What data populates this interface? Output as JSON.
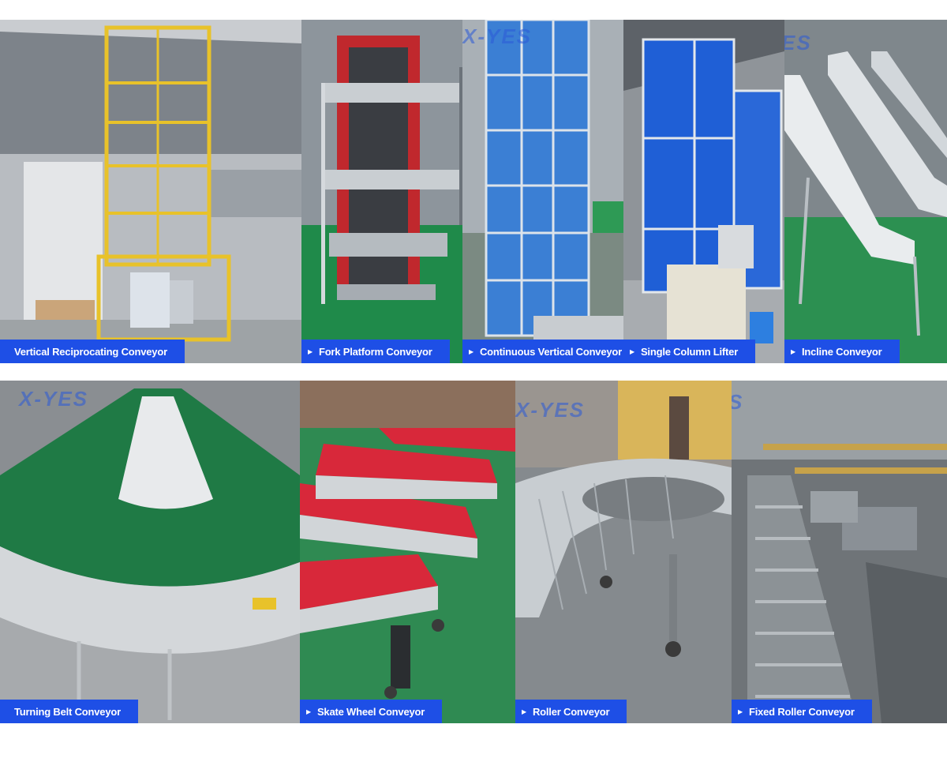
{
  "watermark": "X-YES",
  "row1": [
    {
      "label": "Vertical Reciprocating Conveyor",
      "arrow": false
    },
    {
      "label": "Fork Platform Conveyor",
      "arrow": true
    },
    {
      "label": "Continuous Vertical Conveyor",
      "arrow": true
    },
    {
      "label": "Single Column Lifter",
      "arrow": true
    },
    {
      "label": "Incline Conveyor",
      "arrow": true
    }
  ],
  "row2": [
    {
      "label": "Turning Belt Conveyor",
      "arrow": false
    },
    {
      "label": "Skate Wheel Conveyor",
      "arrow": true
    },
    {
      "label": "Roller Conveyor",
      "arrow": true
    },
    {
      "label": "Fixed Roller Conveyor",
      "arrow": true
    }
  ],
  "colors": {
    "label_bg": "#1e4fe6",
    "label_text": "#ffffff",
    "floor_green": "#1f8a4a"
  }
}
